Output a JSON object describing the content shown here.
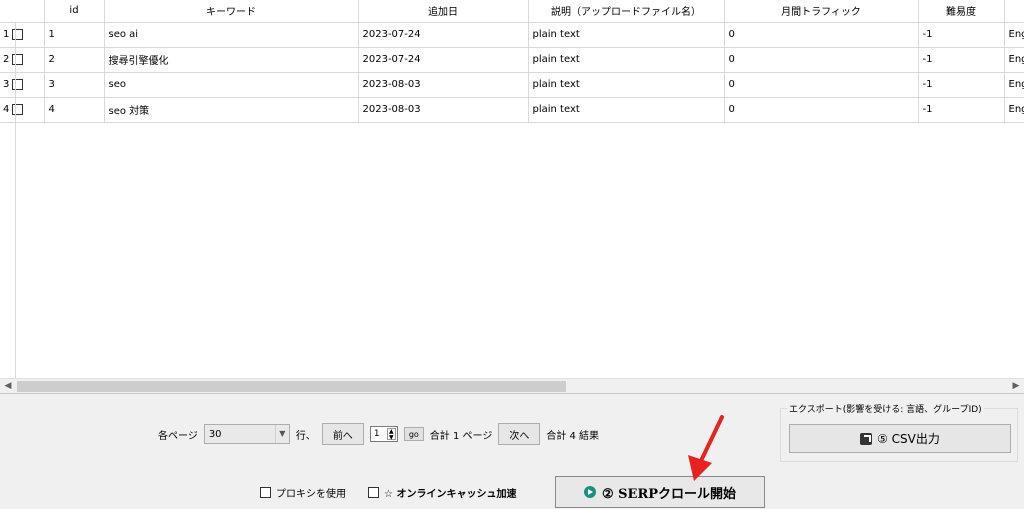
{
  "table": {
    "columns": [
      "id",
      "キーワード",
      "追加日",
      "説明（アップロードファイル名）",
      "月間トラフィック",
      "難易度"
    ],
    "rows": [
      {
        "num": "1",
        "id": "1",
        "keyword": "seo ai",
        "date": "2023-07-24",
        "desc": "plain text",
        "traffic": "0",
        "difficulty": "-1",
        "lang": "Eng"
      },
      {
        "num": "2",
        "id": "2",
        "keyword": "搜尋引擎優化",
        "date": "2023-07-24",
        "desc": "plain text",
        "traffic": "0",
        "difficulty": "-1",
        "lang": "Eng"
      },
      {
        "num": "3",
        "id": "3",
        "keyword": "seo",
        "date": "2023-08-03",
        "desc": "plain text",
        "traffic": "0",
        "difficulty": "-1",
        "lang": "Eng"
      },
      {
        "num": "4",
        "id": "4",
        "keyword": "seo 対策",
        "date": "2023-08-03",
        "desc": "plain text",
        "traffic": "0",
        "difficulty": "-1",
        "lang": "Eng"
      }
    ]
  },
  "pager": {
    "per_page_label": "各ページ",
    "per_page_value": "30",
    "rows_label": "行、",
    "prev_label": "前へ",
    "page_value": "1",
    "go_label": "go",
    "total_pages_label": "合計 1 ページ",
    "next_label": "次へ",
    "total_results_label": "合計 4 結果"
  },
  "export": {
    "legend": "エクスポート(影響を受ける: 言語、グループID)",
    "csv_label": "⑤ CSV出力"
  },
  "bottom": {
    "proxy_label": "プロキシを使用",
    "cache_label": "☆ オンラインキャッシュ加速",
    "start_label": "② SERPクロール開始"
  },
  "colors": {
    "arrow": "#e8231f",
    "play": "#1b8f7f"
  }
}
